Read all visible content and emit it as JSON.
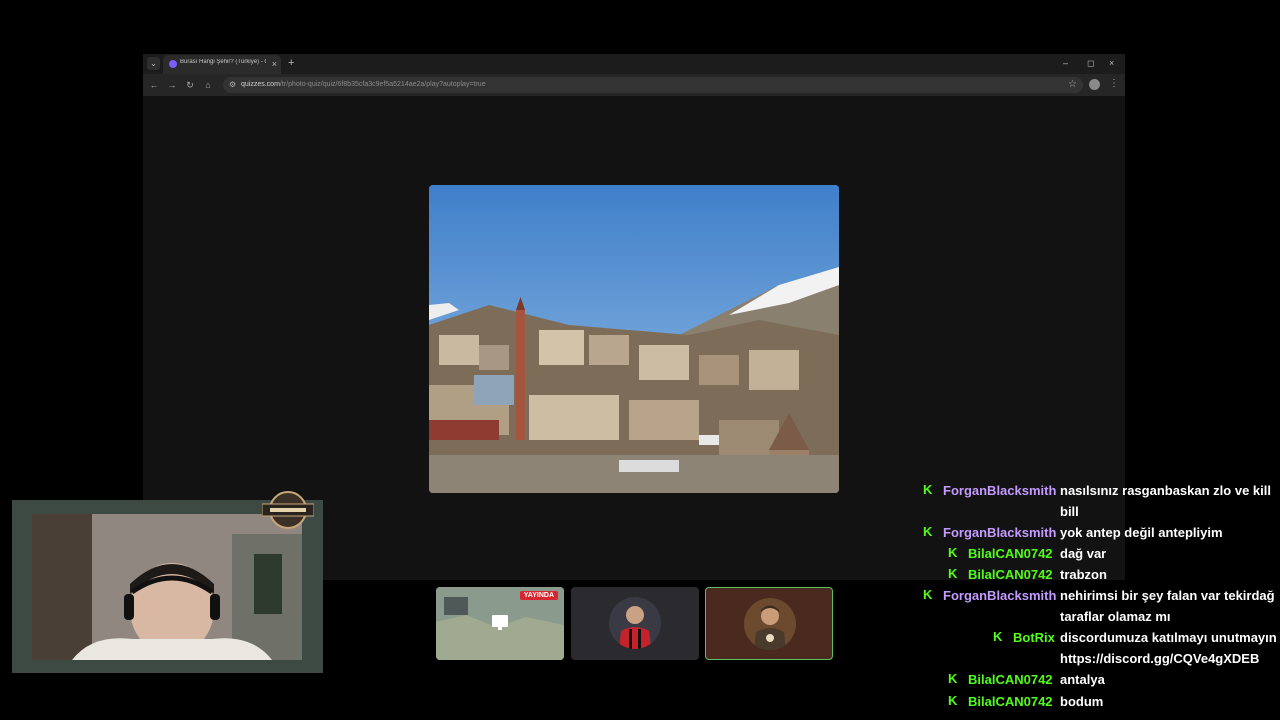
{
  "browser": {
    "tab_title": "Burası Hangi Şehir? (Türkiye) - Q",
    "tab_close": "×",
    "new_tab": "+",
    "dropdown": "⌄",
    "window_controls": {
      "minimize": "–",
      "maximize": "◻",
      "close": "×"
    },
    "nav": {
      "back": "←",
      "forward": "→",
      "reload": "↻",
      "home": "⌂"
    },
    "url_host": "quizzes.com",
    "url_path": "/tr/photo-quiz/quiz/6f8b35cfa3c9ef5a5214ae2a/play?autoplay=true",
    "star": "☆",
    "menu": "⋮"
  },
  "thumbnails": [
    {
      "name": "live-map-thumbnail",
      "badge": "YAYINDA"
    },
    {
      "name": "player-thumbnail"
    },
    {
      "name": "streamer-thumbnail"
    }
  ],
  "chat": {
    "user_color_purple": "#c49bff",
    "user_color_green": "#53fc18",
    "messages": [
      {
        "user": "ForganBlacksmith",
        "text": "nasılsınız rasganbaskan zlo ve kill bill",
        "color": "#c49bff"
      },
      {
        "user": "ForganBlacksmith",
        "text": "yok antep değil antepliyim",
        "color": "#c49bff"
      },
      {
        "user": "BilalCAN0742",
        "text": "dağ var",
        "color": "#53fc18"
      },
      {
        "user": "BilalCAN0742",
        "text": "trabzon",
        "color": "#53fc18"
      },
      {
        "user": "ForganBlacksmith",
        "text": "nehirimsi bir şey falan var tekirdağ taraflar olamaz mı",
        "color": "#c49bff"
      },
      {
        "user": "BotRix",
        "text": "discordumuza katılmayı unutmayın https://discord.gg/CQVe4gXDEB",
        "color": "#53fc18"
      },
      {
        "user": "BilalCAN0742",
        "text": "antalya",
        "color": "#53fc18"
      },
      {
        "user": "BilalCAN0742",
        "text": "bodum",
        "color": "#53fc18"
      }
    ],
    "badge_icon": "kick-icon"
  }
}
